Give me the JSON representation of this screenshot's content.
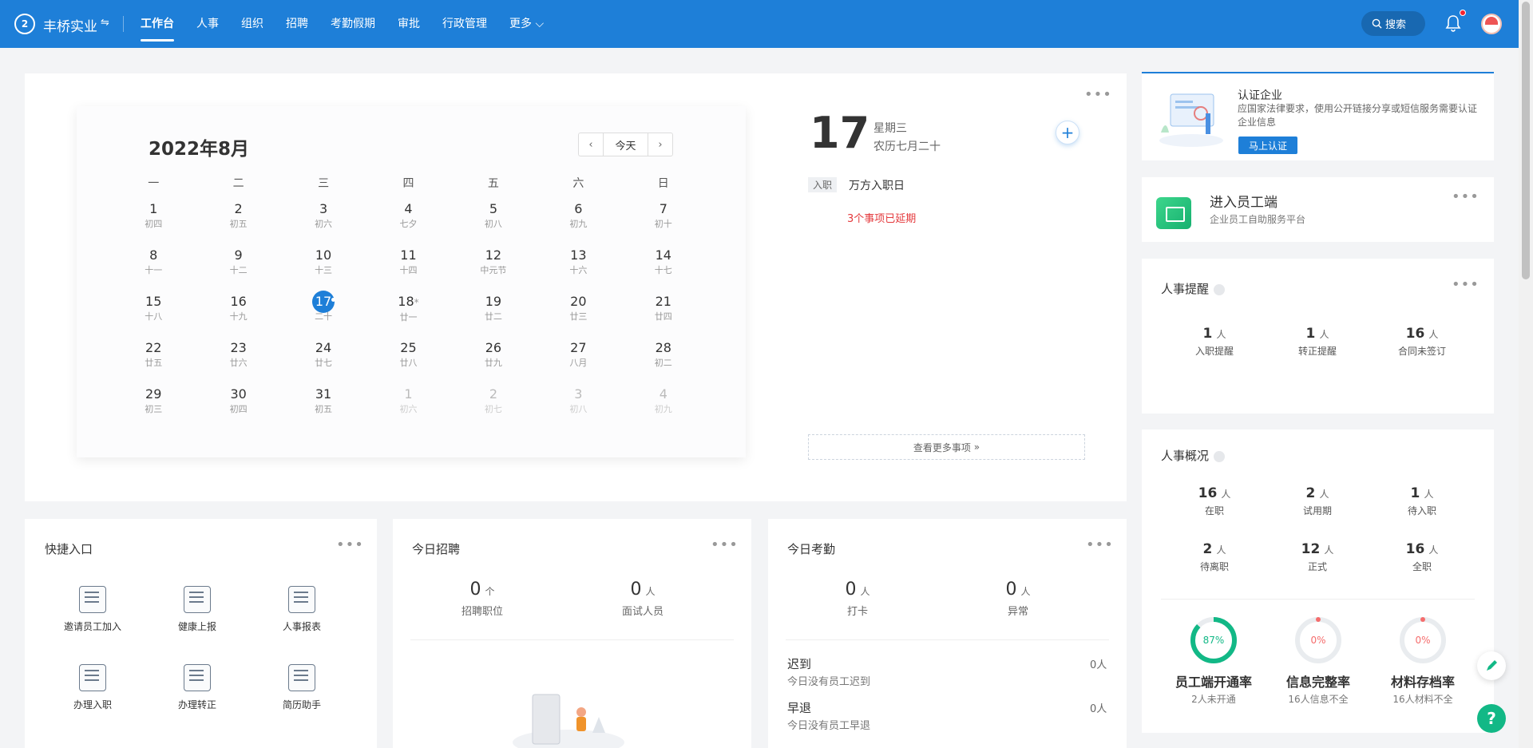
{
  "header": {
    "logo_text": "2",
    "company": "丰桥实业",
    "nav": [
      "工作台",
      "人事",
      "组织",
      "招聘",
      "考勤假期",
      "审批",
      "行政管理",
      "更多"
    ],
    "search_label": "搜索"
  },
  "calendar": {
    "title": "2022年8月",
    "today_button": "今天",
    "weekdays": [
      "一",
      "二",
      "三",
      "四",
      "五",
      "六",
      "日"
    ],
    "days": [
      {
        "d": "1",
        "l": "初四"
      },
      {
        "d": "2",
        "l": "初五"
      },
      {
        "d": "3",
        "l": "初六"
      },
      {
        "d": "4",
        "l": "七夕"
      },
      {
        "d": "5",
        "l": "初八"
      },
      {
        "d": "6",
        "l": "初九"
      },
      {
        "d": "7",
        "l": "初十"
      },
      {
        "d": "8",
        "l": "十一"
      },
      {
        "d": "9",
        "l": "十二"
      },
      {
        "d": "10",
        "l": "十三"
      },
      {
        "d": "11",
        "l": "十四"
      },
      {
        "d": "12",
        "l": "中元节"
      },
      {
        "d": "13",
        "l": "十六"
      },
      {
        "d": "14",
        "l": "十七"
      },
      {
        "d": "15",
        "l": "十八"
      },
      {
        "d": "16",
        "l": "十九"
      },
      {
        "d": "17",
        "l": "二十"
      },
      {
        "d": "18",
        "l": "廿一"
      },
      {
        "d": "19",
        "l": "廿二"
      },
      {
        "d": "20",
        "l": "廿三"
      },
      {
        "d": "21",
        "l": "廿四"
      },
      {
        "d": "22",
        "l": "廿五"
      },
      {
        "d": "23",
        "l": "廿六"
      },
      {
        "d": "24",
        "l": "廿七"
      },
      {
        "d": "25",
        "l": "廿八"
      },
      {
        "d": "26",
        "l": "廿九"
      },
      {
        "d": "27",
        "l": "八月"
      },
      {
        "d": "28",
        "l": "初二"
      },
      {
        "d": "29",
        "l": "初三"
      },
      {
        "d": "30",
        "l": "初四"
      },
      {
        "d": "31",
        "l": "初五"
      },
      {
        "d": "1",
        "l": "初六"
      },
      {
        "d": "2",
        "l": "初七"
      },
      {
        "d": "3",
        "l": "初八"
      },
      {
        "d": "4",
        "l": "初九"
      }
    ]
  },
  "agenda": {
    "day": "17",
    "weekday": "星期三",
    "lunar": "农历七月二十",
    "tag": "入职",
    "event": "万方入职日",
    "overdue": "3个事项已延期",
    "view_more": "查看更多事项"
  },
  "quick": {
    "title": "快捷入口",
    "items": [
      "邀请员工加入",
      "健康上报",
      "人事报表",
      "办理入职",
      "办理转正",
      "简历助手"
    ]
  },
  "recruit": {
    "title": "今日招聘",
    "stats": [
      {
        "value": "0",
        "unit": "个",
        "label": "招聘职位"
      },
      {
        "value": "0",
        "unit": "人",
        "label": "面试人员"
      }
    ]
  },
  "attendance": {
    "title": "今日考勤",
    "stats": [
      {
        "value": "0",
        "unit": "人",
        "label": "打卡"
      },
      {
        "value": "0",
        "unit": "人",
        "label": "异常"
      }
    ],
    "rows": [
      {
        "title": "迟到",
        "sub": "今日没有员工迟到",
        "value": "0人"
      },
      {
        "title": "早退",
        "sub": "今日没有员工早退",
        "value": "0人"
      }
    ]
  },
  "cert": {
    "title": "认证企业",
    "desc": "应国家法律要求，使用公开链接分享或短信服务需要认证企业信息",
    "button": "马上认证"
  },
  "employee_portal": {
    "title": "进入员工端",
    "subtitle": "企业员工自助服务平台"
  },
  "hr_reminder": {
    "title": "人事提醒",
    "stats": [
      {
        "value": "1",
        "unit": "人",
        "label": "入职提醒"
      },
      {
        "value": "1",
        "unit": "人",
        "label": "转正提醒"
      },
      {
        "value": "16",
        "unit": "人",
        "label": "合同未签订"
      }
    ]
  },
  "hr_overview": {
    "title": "人事概况",
    "stats": [
      {
        "value": "16",
        "unit": "人",
        "label": "在职"
      },
      {
        "value": "2",
        "unit": "人",
        "label": "试用期"
      },
      {
        "value": "1",
        "unit": "人",
        "label": "待入职"
      },
      {
        "value": "2",
        "unit": "人",
        "label": "待离职"
      },
      {
        "value": "12",
        "unit": "人",
        "label": "正式"
      },
      {
        "value": "16",
        "unit": "人",
        "label": "全职"
      }
    ],
    "rings": [
      {
        "pct": "87%",
        "fraction": 0.87,
        "label": "员工端开通率",
        "sub": "2人未开通",
        "color": "#12b886"
      },
      {
        "pct": "0%",
        "fraction": 0,
        "label": "信息完整率",
        "sub": "16人信息不全",
        "color": "#f56c6c"
      },
      {
        "pct": "0%",
        "fraction": 0,
        "label": "材料存档率",
        "sub": "16人材料不全",
        "color": "#f56c6c"
      }
    ]
  },
  "help_label": "?"
}
